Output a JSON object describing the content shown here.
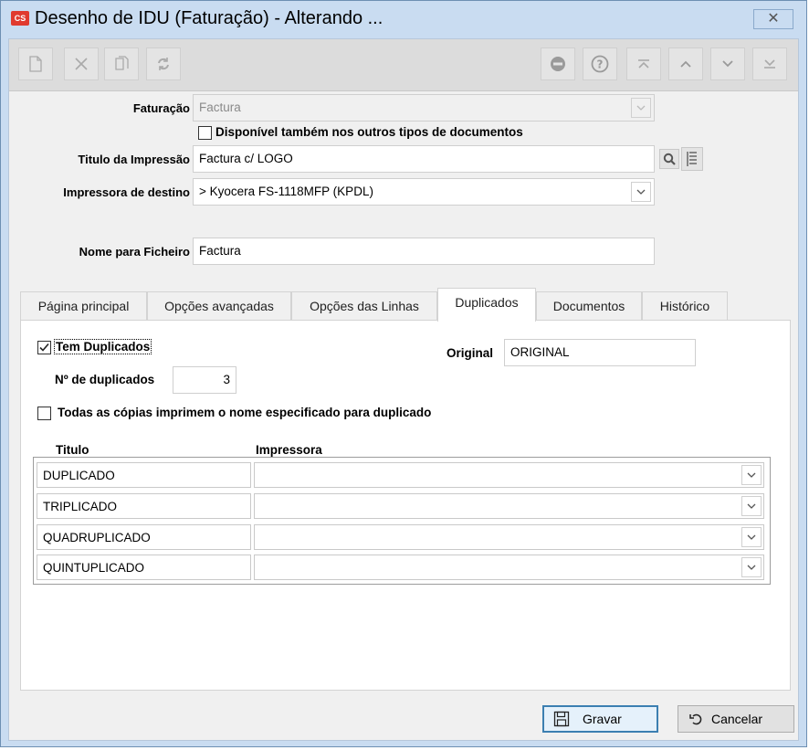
{
  "window": {
    "title": "Desenho de IDU (Faturação) - Alterando ...",
    "app_icon_text": "CS",
    "close_glyph": "✕"
  },
  "toolbar": {
    "left_buttons": [
      "new-document-icon",
      "delete-icon",
      "copy-icon",
      "refresh-icon"
    ],
    "right_buttons": [
      "options-icon",
      "help-icon",
      "first-record-icon",
      "previous-record-icon",
      "next-record-icon",
      "last-record-icon"
    ]
  },
  "form": {
    "faturacao_label": "Faturação",
    "faturacao_value": "Factura",
    "disponivel_label": "Disponível também nos outros tipos de documentos",
    "titulo_label": "Titulo da Impressão",
    "titulo_value": "Factura c/ LOGO",
    "impressora_label": "Impressora de destino",
    "impressora_value": "> Kyocera FS-1118MFP (KPDL)",
    "nome_label": "Nome para Ficheiro",
    "nome_value": "Factura"
  },
  "tabs": [
    "Página principal",
    "Opções avançadas",
    "Opções das Linhas",
    "Duplicados",
    "Documentos",
    "Histórico"
  ],
  "active_tab": "Duplicados",
  "duplicados": {
    "tem_duplicados_label": "Tem Duplicados",
    "tem_duplicados_checked": true,
    "original_label": "Original",
    "original_value": "ORIGINAL",
    "num_label": "Nº de duplicados",
    "num_value": "3",
    "todas_label": "Todas as cópias imprimem o nome especificado para duplicado",
    "todas_checked": false,
    "col_titulo": "Titulo",
    "col_impressora": "Impressora",
    "rows": [
      {
        "titulo": "DUPLICADO",
        "impressora": ""
      },
      {
        "titulo": "TRIPLICADO",
        "impressora": ""
      },
      {
        "titulo": "QUADRUPLICADO",
        "impressora": ""
      },
      {
        "titulo": "QUINTUPLICADO",
        "impressora": ""
      }
    ]
  },
  "buttons": {
    "gravar": "Gravar",
    "cancelar": "Cancelar"
  }
}
